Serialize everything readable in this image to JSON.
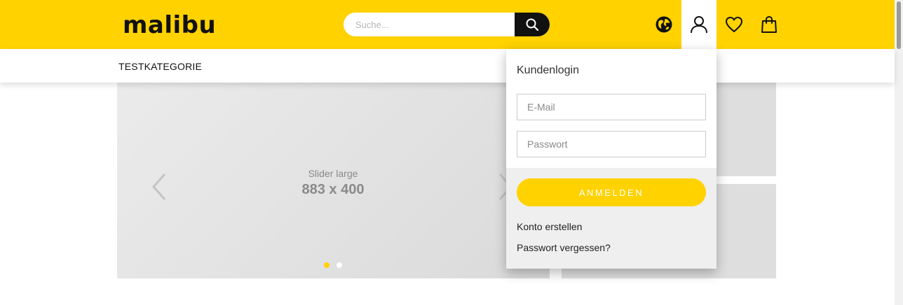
{
  "header": {
    "logo": "malibu",
    "search": {
      "placeholder": "Suche..."
    },
    "icons": [
      "globe-icon",
      "user-icon",
      "heart-icon",
      "shopping-bag-icon"
    ]
  },
  "nav": {
    "items": [
      {
        "label": "TESTKATEGORIE"
      }
    ]
  },
  "slider": {
    "subtitle": "Slider large",
    "size": "883 x 400",
    "active_dot": 0,
    "dot_count": 2
  },
  "login": {
    "title": "Kundenlogin",
    "email_placeholder": "E-Mail",
    "password_placeholder": "Passwort",
    "submit_label": "ANMELDEN",
    "create_account": "Konto erstellen",
    "forgot_password": "Passwort vergessen?"
  },
  "colors": {
    "brand_yellow": "#ffd200",
    "dark": "#111111",
    "dot_inactive": "#ffffff"
  }
}
